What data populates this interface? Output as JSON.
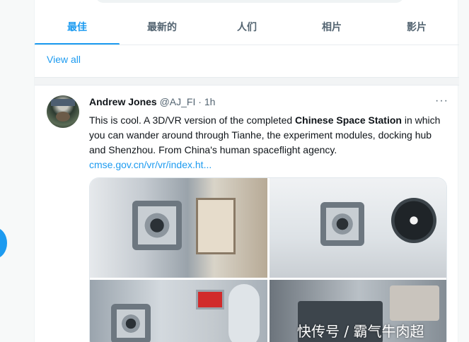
{
  "tabs": [
    {
      "label": "最佳",
      "active": true
    },
    {
      "label": "最新的"
    },
    {
      "label": "人们"
    },
    {
      "label": "相片"
    },
    {
      "label": "影片"
    }
  ],
  "view_all": "View all",
  "tweet": {
    "name": "Andrew Jones",
    "handle": "@AJ_FI",
    "separator": "·",
    "time": "1h",
    "more": "···",
    "text_before": "This is cool. A 3D/VR version of the completed ",
    "text_bold": "Chinese Space Station",
    "text_after": " in which you can wander around through Tianhe, the experiment modules, docking hub and Shenzhou. From China's human spaceflight agency.",
    "link": "cmse.gov.cn/vr/vr/index.ht..."
  },
  "watermark": "快传号 / 霸气牛肉超",
  "colors": {
    "accent": "#1d9bf0",
    "text": "#0f1419",
    "muted": "#536471"
  }
}
